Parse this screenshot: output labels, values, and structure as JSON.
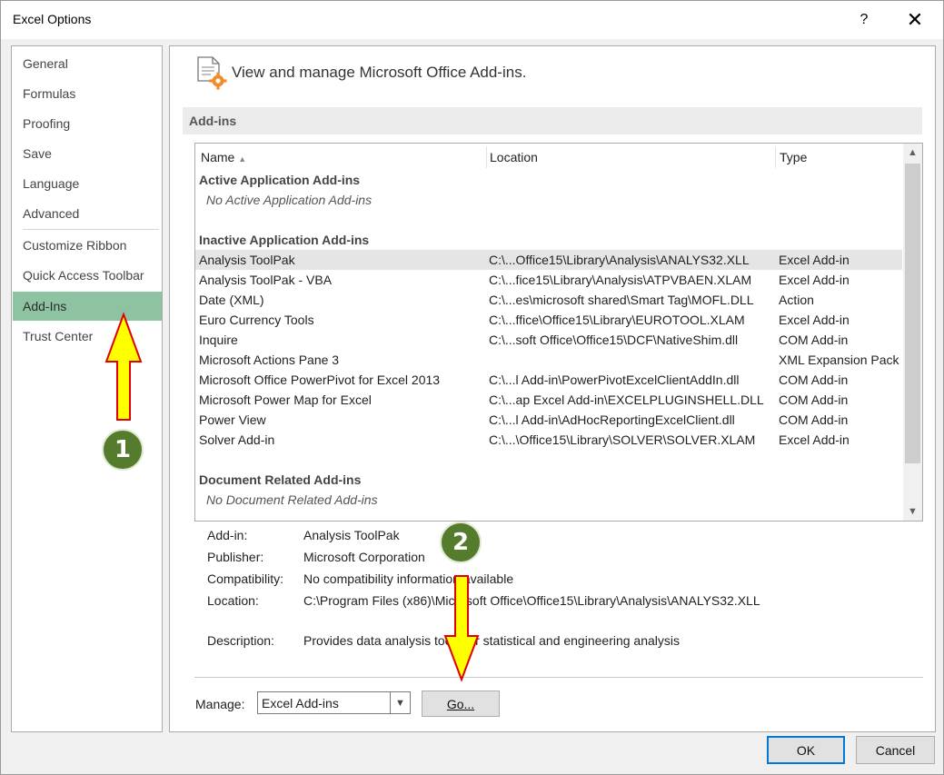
{
  "window": {
    "title": "Excel Options",
    "help_glyph": "?",
    "close_glyph": "✕"
  },
  "sidebar": {
    "items": [
      {
        "label": "General"
      },
      {
        "label": "Formulas"
      },
      {
        "label": "Proofing"
      },
      {
        "label": "Save"
      },
      {
        "label": "Language"
      },
      {
        "label": "Advanced"
      },
      {
        "label": "Customize Ribbon"
      },
      {
        "label": "Quick Access Toolbar"
      },
      {
        "label": "Add-Ins",
        "active": true
      },
      {
        "label": "Trust Center"
      }
    ]
  },
  "main": {
    "header": "View and manage Microsoft Office Add-ins.",
    "section_title": "Add-ins",
    "columns": {
      "name": "Name",
      "location": "Location",
      "type": "Type",
      "sort_glyph": "▲"
    },
    "groups": {
      "active": {
        "title": "Active Application Add-ins",
        "empty": "No Active Application Add-ins"
      },
      "inactive": {
        "title": "Inactive Application Add-ins"
      },
      "document": {
        "title": "Document Related Add-ins",
        "empty": "No Document Related Add-ins"
      }
    },
    "rows": [
      {
        "name": "Analysis ToolPak",
        "location": "C:\\...Office15\\Library\\Analysis\\ANALYS32.XLL",
        "type": "Excel Add-in",
        "selected": true
      },
      {
        "name": "Analysis ToolPak - VBA",
        "location": "C:\\...fice15\\Library\\Analysis\\ATPVBAEN.XLAM",
        "type": "Excel Add-in"
      },
      {
        "name": "Date (XML)",
        "location": "C:\\...es\\microsoft shared\\Smart Tag\\MOFL.DLL",
        "type": "Action"
      },
      {
        "name": "Euro Currency Tools",
        "location": "C:\\...ffice\\Office15\\Library\\EUROTOOL.XLAM",
        "type": "Excel Add-in"
      },
      {
        "name": "Inquire",
        "location": "C:\\...soft Office\\Office15\\DCF\\NativeShim.dll",
        "type": "COM Add-in"
      },
      {
        "name": "Microsoft Actions Pane 3",
        "location": "",
        "type": "XML Expansion Pack"
      },
      {
        "name": "Microsoft Office PowerPivot for Excel 2013",
        "location": "C:\\...l Add-in\\PowerPivotExcelClientAddIn.dll",
        "type": "COM Add-in"
      },
      {
        "name": "Microsoft Power Map for Excel",
        "location": "C:\\...ap Excel Add-in\\EXCELPLUGINSHELL.DLL",
        "type": "COM Add-in"
      },
      {
        "name": "Power View",
        "location": "C:\\...l Add-in\\AdHocReportingExcelClient.dll",
        "type": "COM Add-in"
      },
      {
        "name": "Solver Add-in",
        "location": "C:\\...\\Office15\\Library\\SOLVER\\SOLVER.XLAM",
        "type": "Excel Add-in"
      }
    ],
    "details": {
      "addin_label": "Add-in:",
      "addin_value": "Analysis ToolPak",
      "publisher_label": "Publisher:",
      "publisher_value": "Microsoft Corporation",
      "compat_label": "Compatibility:",
      "compat_value": "No compatibility information available",
      "location_label": "Location:",
      "location_value": "C:\\Program Files (x86)\\Microsoft Office\\Office15\\Library\\Analysis\\ANALYS32.XLL",
      "desc_label": "Description:",
      "desc_value": "Provides data analysis tools for statistical and engineering analysis"
    },
    "manage": {
      "label": "Manage:",
      "selected": "Excel Add-ins",
      "go_label": "Go..."
    }
  },
  "footer": {
    "ok_label": "OK",
    "cancel_label": "Cancel"
  },
  "annotations": {
    "step1": "1",
    "step2": "2",
    "arrow_fill": "#ffff00",
    "arrow_stroke": "#e00000",
    "badge_color": "#557b2c"
  }
}
